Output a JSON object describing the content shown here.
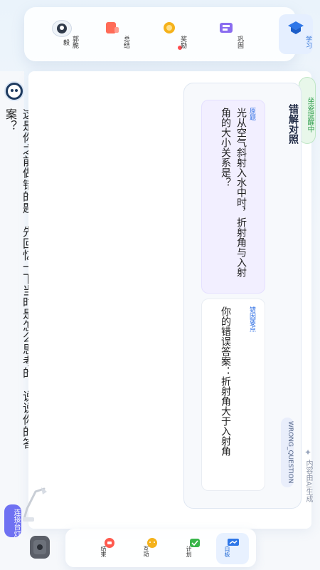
{
  "top_nav": {
    "items": [
      {
        "label": "学习",
        "icon": "study-book-icon",
        "active": true
      },
      {
        "label": "巩固",
        "icon": "consolidate-icon",
        "active": false
      },
      {
        "label": "奖励",
        "icon": "reward-medal-icon",
        "active": false
      },
      {
        "label": "总结",
        "icon": "summary-icon",
        "active": false
      },
      {
        "label": "郭脆毅",
        "icon": "user-avatar",
        "active": false
      }
    ]
  },
  "message": {
    "text": "这是你之前做错的题，先回忆一下当时是怎么思考的，说说你的答案？"
  },
  "panel": {
    "title": "错解对照",
    "status_badge": "坐姿提醒中",
    "type_badge": "WRONG_QUESTION",
    "ai_note": "内容由AI生成",
    "sections": [
      {
        "label": "原题",
        "text": "光从空气斜射入水中时，折射角与入射角的大小关系是？"
      },
      {
        "label": "错因要点",
        "text": "你的错误答案：折射角大于入射角"
      }
    ]
  },
  "bottom_bar": {
    "items": [
      {
        "label": "白板",
        "icon": "whiteboard-icon",
        "active": true
      },
      {
        "label": "计划",
        "icon": "plan-icon",
        "active": false
      },
      {
        "label": "互动",
        "icon": "interact-icon",
        "active": false
      },
      {
        "label": "结束",
        "icon": "end-icon",
        "active": false
      }
    ]
  },
  "connect_lamp": "连接台灯",
  "colors": {
    "accent": "#2a6fd6",
    "purple": "#6f71f2",
    "green": "#2e9c4c"
  }
}
